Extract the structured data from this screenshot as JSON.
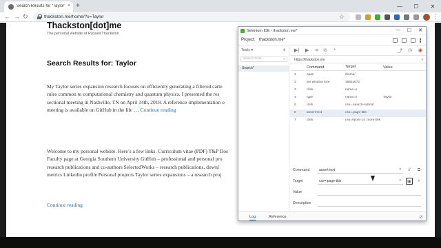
{
  "browser": {
    "tab_title": "Search Results for “Taylor” – Thac",
    "tab_close": "×",
    "new_tab": "+",
    "url": "thackston.me/home/?s=Taylor",
    "controls": {
      "minimize": "—",
      "maximize": "☐",
      "close": "✕"
    },
    "nav": {
      "back": "←",
      "forward": "→",
      "reload": "↻"
    },
    "bookmark_star": "☆",
    "menu": "⋮"
  },
  "site": {
    "title": "Thackston[dot]me",
    "tagline": "The personal website of Russell Thackston",
    "search_heading": "Search Results for: Taylor",
    "posts": [
      {
        "lines": [
          "My Taylor series expansion research focuses on efficiently generating a filtered carte",
          "rules common to computational chemistry and quantum physics. I presented the res",
          "sectional meeting in Nashville, TN on April 14th, 2018. A reference implementation o",
          "meeting is available on GitHub in the lib/ …"
        ],
        "more": "Continue reading"
      },
      {
        "lines": [
          "Welcome to my personal website. Here’s a few links. Curriculum vitae (PDF) T&P Dos",
          "Faculty page at Georgia Southern University GitHub – professional and personal pro",
          "research publications and co-authors SelectedWorks – research publications, downl",
          "metrics Linkedin profile Personal projects Taylor series expansions – a research proj"
        ],
        "more": "Continue reading"
      }
    ]
  },
  "ide": {
    "window_title": "Selenium IDE - thackston.me*",
    "window_controls": {
      "minimize": "—",
      "maximize": "☐",
      "close": "✕"
    },
    "project_label": "Project:",
    "project_name": "thackston.me*",
    "tests_header": "Tests ▾",
    "add_test": "+",
    "search_placeholder": "Search tests...",
    "test_item": "Search*",
    "base_url": "https://thackston.me",
    "columns": {
      "command": "Command",
      "target": "Target",
      "value": "Value"
    },
    "rows": [
      {
        "num": "1",
        "command": "open",
        "target": "/home/",
        "value": ""
      },
      {
        "num": "2",
        "command": "set window size",
        "target": "1554x872",
        "value": ""
      },
      {
        "num": "3",
        "command": "click",
        "target": "name=s",
        "value": ""
      },
      {
        "num": "4",
        "command": "type",
        "target": "name=s",
        "value": "Taylor"
      },
      {
        "num": "5",
        "command": "click",
        "target": "css=.search-submit",
        "value": ""
      },
      {
        "num": "6",
        "command": "assert text",
        "target": "css=.page-title",
        "value": ""
      },
      {
        "num": "7",
        "command": "click",
        "target": "css=#post-14 .more-link",
        "value": ""
      }
    ],
    "selected_row": 6,
    "editor": {
      "command_label": "Command",
      "command_value": "assert text",
      "target_label": "Target",
      "target_value": "css=.page-title",
      "value_label": "Value",
      "value_value": "",
      "description_label": "Description",
      "description_value": ""
    },
    "footer": {
      "log": "Log",
      "reference": "Reference"
    }
  },
  "colors": {
    "link": "#1f6ea8",
    "selenium_green": "#43b02a",
    "selected_row": "#e8edf3"
  }
}
